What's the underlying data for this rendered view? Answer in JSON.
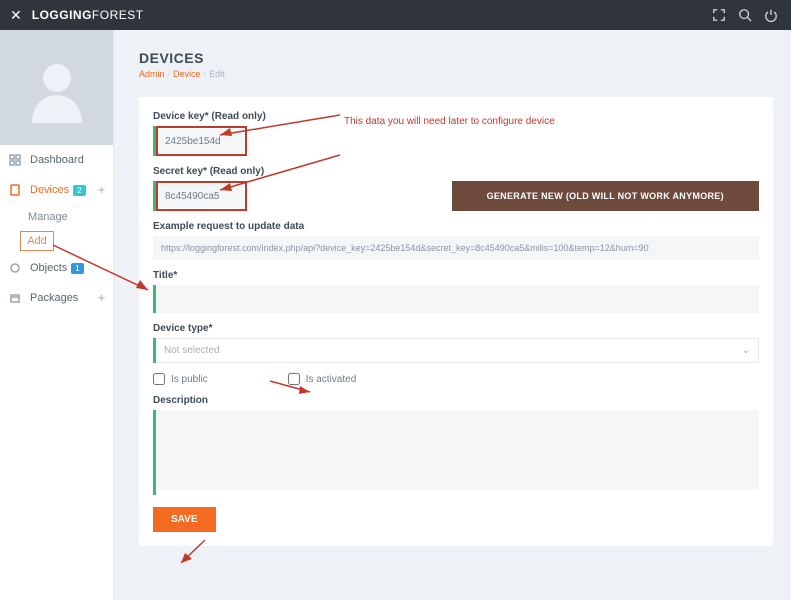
{
  "topbar": {
    "brand_bold": "LOGGING",
    "brand_light": "FOREST"
  },
  "sidebar": {
    "dashboard": "Dashboard",
    "devices": "Devices",
    "devices_badge": "2",
    "manage": "Manage",
    "add": "Add",
    "objects": "Objects",
    "objects_badge": "1",
    "packages": "Packages"
  },
  "page": {
    "title": "DEVICES",
    "bc_admin": "Admin",
    "bc_device": "Device",
    "bc_edit": "Edit"
  },
  "form": {
    "device_key_label": "Device key* (Read only)",
    "device_key_value": "2425be154d",
    "note": "This data you will need later to configure device",
    "secret_key_label": "Secret key* (Read only)",
    "secret_key_value": "8c45490ca5",
    "generate_btn": "GENERATE NEW (OLD WILL NOT WORK ANYMORE)",
    "example_label": "Example request to update data",
    "example_url": "https://loggingforest.com/index.php/api?device_key=2425be154d&secret_key=8c45490ca5&milis=100&temp=12&hum=90",
    "title_label": "Title*",
    "title_value": "",
    "device_type_label": "Device type*",
    "device_type_value": "Not selected",
    "is_public": "Is public",
    "is_activated": "Is activated",
    "description_label": "Description",
    "description_value": "",
    "save_btn": "SAVE"
  }
}
